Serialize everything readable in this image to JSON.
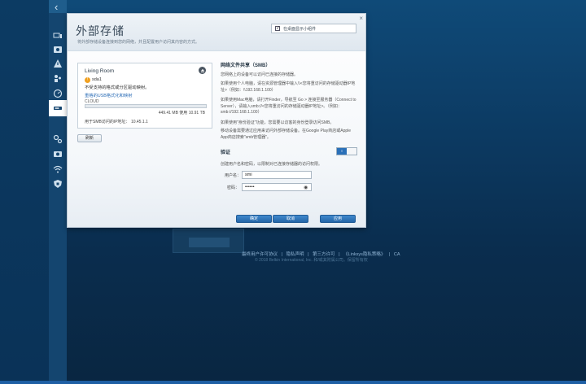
{
  "sidebar": {
    "icons": [
      "devices-icon",
      "media-icon",
      "alert-icon",
      "parental-icon",
      "speed-icon",
      "storage-icon",
      "settings-icon",
      "camera-icon",
      "wifi-icon",
      "security-icon"
    ],
    "active_index": 5
  },
  "modal": {
    "title": "外部存储",
    "subtitle": "将外部存储设备连接到您的网络，并且配置用户访问其内容的方式。",
    "desktop_checkbox_label": "在桌面显示小组件",
    "close_symbol": "×"
  },
  "storage": {
    "location": "Living Room",
    "drive_name": "sda1",
    "drive_message": "不受支持的格式或分区驱动映射。",
    "format_link": "重格的USB格式化和映射",
    "filesystem": "CLOUD",
    "usage_percent": 0,
    "usage_text": "449.41 MB 使用 10.91 TB",
    "smb_ip_label": "用于SMB访问的IP地址：",
    "smb_ip": "10.45.1.1",
    "refresh_label": "刷新"
  },
  "smb": {
    "title": "网络文件共享（SMB）",
    "p1": "您网络上的设备可以访问已连接的存储器。",
    "p2": "如果使用个人电脑，请在资源管理器中输入\\\\<您将重访问的存储驱动器IP地址>（例如：\\\\192.168.1.100）",
    "p3": "如果使用Mac电脑，请打开Finder，导航至 Go > 连接至服务器（Connect to Server），请输入smb://<您将重访问的存储驱动器IP地址>。（例如：smb://192.168.1.100）",
    "p4": "如果使用\"身份验证\"功能，您需要以访客的身份登录访问SMB。",
    "p5": "移动设备需要通过应用来访问外部存储设备。在Google Play商店或Apple App商店搜索\"smb管理器\"。"
  },
  "auth": {
    "title": "验证",
    "toggle_on_label": "I",
    "description": "创建用户名和密码，以限制对已连接存储器的访问权限。",
    "username_label": "用户名：",
    "username_value": "smi",
    "password_label": "密码：",
    "password_value": "••••••"
  },
  "buttons": {
    "ok": "确定",
    "cancel": "取消",
    "apply": "应用"
  },
  "footer": {
    "links": [
      "最终用户许可协议",
      "|",
      "隐私声明",
      "|",
      "第三方许可",
      "|",
      "《Linksys隐私策略》",
      "|",
      "CA"
    ],
    "copyright": "© 2018 Belkin International, Inc. 和/或其附属公司。保留所有权"
  }
}
